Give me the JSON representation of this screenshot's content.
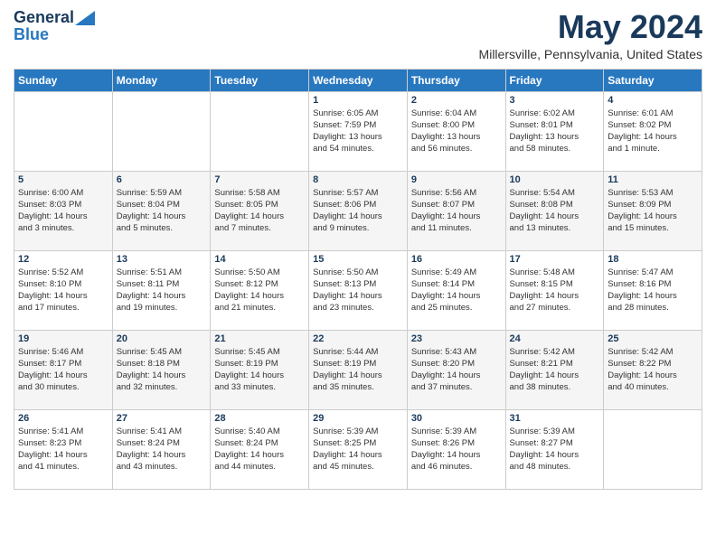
{
  "header": {
    "logo_line1": "General",
    "logo_line2": "Blue",
    "month_title": "May 2024",
    "location": "Millersville, Pennsylvania, United States"
  },
  "days_of_week": [
    "Sunday",
    "Monday",
    "Tuesday",
    "Wednesday",
    "Thursday",
    "Friday",
    "Saturday"
  ],
  "weeks": [
    [
      {
        "num": "",
        "info": ""
      },
      {
        "num": "",
        "info": ""
      },
      {
        "num": "",
        "info": ""
      },
      {
        "num": "1",
        "info": "Sunrise: 6:05 AM\nSunset: 7:59 PM\nDaylight: 13 hours\nand 54 minutes."
      },
      {
        "num": "2",
        "info": "Sunrise: 6:04 AM\nSunset: 8:00 PM\nDaylight: 13 hours\nand 56 minutes."
      },
      {
        "num": "3",
        "info": "Sunrise: 6:02 AM\nSunset: 8:01 PM\nDaylight: 13 hours\nand 58 minutes."
      },
      {
        "num": "4",
        "info": "Sunrise: 6:01 AM\nSunset: 8:02 PM\nDaylight: 14 hours\nand 1 minute."
      }
    ],
    [
      {
        "num": "5",
        "info": "Sunrise: 6:00 AM\nSunset: 8:03 PM\nDaylight: 14 hours\nand 3 minutes."
      },
      {
        "num": "6",
        "info": "Sunrise: 5:59 AM\nSunset: 8:04 PM\nDaylight: 14 hours\nand 5 minutes."
      },
      {
        "num": "7",
        "info": "Sunrise: 5:58 AM\nSunset: 8:05 PM\nDaylight: 14 hours\nand 7 minutes."
      },
      {
        "num": "8",
        "info": "Sunrise: 5:57 AM\nSunset: 8:06 PM\nDaylight: 14 hours\nand 9 minutes."
      },
      {
        "num": "9",
        "info": "Sunrise: 5:56 AM\nSunset: 8:07 PM\nDaylight: 14 hours\nand 11 minutes."
      },
      {
        "num": "10",
        "info": "Sunrise: 5:54 AM\nSunset: 8:08 PM\nDaylight: 14 hours\nand 13 minutes."
      },
      {
        "num": "11",
        "info": "Sunrise: 5:53 AM\nSunset: 8:09 PM\nDaylight: 14 hours\nand 15 minutes."
      }
    ],
    [
      {
        "num": "12",
        "info": "Sunrise: 5:52 AM\nSunset: 8:10 PM\nDaylight: 14 hours\nand 17 minutes."
      },
      {
        "num": "13",
        "info": "Sunrise: 5:51 AM\nSunset: 8:11 PM\nDaylight: 14 hours\nand 19 minutes."
      },
      {
        "num": "14",
        "info": "Sunrise: 5:50 AM\nSunset: 8:12 PM\nDaylight: 14 hours\nand 21 minutes."
      },
      {
        "num": "15",
        "info": "Sunrise: 5:50 AM\nSunset: 8:13 PM\nDaylight: 14 hours\nand 23 minutes."
      },
      {
        "num": "16",
        "info": "Sunrise: 5:49 AM\nSunset: 8:14 PM\nDaylight: 14 hours\nand 25 minutes."
      },
      {
        "num": "17",
        "info": "Sunrise: 5:48 AM\nSunset: 8:15 PM\nDaylight: 14 hours\nand 27 minutes."
      },
      {
        "num": "18",
        "info": "Sunrise: 5:47 AM\nSunset: 8:16 PM\nDaylight: 14 hours\nand 28 minutes."
      }
    ],
    [
      {
        "num": "19",
        "info": "Sunrise: 5:46 AM\nSunset: 8:17 PM\nDaylight: 14 hours\nand 30 minutes."
      },
      {
        "num": "20",
        "info": "Sunrise: 5:45 AM\nSunset: 8:18 PM\nDaylight: 14 hours\nand 32 minutes."
      },
      {
        "num": "21",
        "info": "Sunrise: 5:45 AM\nSunset: 8:19 PM\nDaylight: 14 hours\nand 33 minutes."
      },
      {
        "num": "22",
        "info": "Sunrise: 5:44 AM\nSunset: 8:19 PM\nDaylight: 14 hours\nand 35 minutes."
      },
      {
        "num": "23",
        "info": "Sunrise: 5:43 AM\nSunset: 8:20 PM\nDaylight: 14 hours\nand 37 minutes."
      },
      {
        "num": "24",
        "info": "Sunrise: 5:42 AM\nSunset: 8:21 PM\nDaylight: 14 hours\nand 38 minutes."
      },
      {
        "num": "25",
        "info": "Sunrise: 5:42 AM\nSunset: 8:22 PM\nDaylight: 14 hours\nand 40 minutes."
      }
    ],
    [
      {
        "num": "26",
        "info": "Sunrise: 5:41 AM\nSunset: 8:23 PM\nDaylight: 14 hours\nand 41 minutes."
      },
      {
        "num": "27",
        "info": "Sunrise: 5:41 AM\nSunset: 8:24 PM\nDaylight: 14 hours\nand 43 minutes."
      },
      {
        "num": "28",
        "info": "Sunrise: 5:40 AM\nSunset: 8:24 PM\nDaylight: 14 hours\nand 44 minutes."
      },
      {
        "num": "29",
        "info": "Sunrise: 5:39 AM\nSunset: 8:25 PM\nDaylight: 14 hours\nand 45 minutes."
      },
      {
        "num": "30",
        "info": "Sunrise: 5:39 AM\nSunset: 8:26 PM\nDaylight: 14 hours\nand 46 minutes."
      },
      {
        "num": "31",
        "info": "Sunrise: 5:39 AM\nSunset: 8:27 PM\nDaylight: 14 hours\nand 48 minutes."
      },
      {
        "num": "",
        "info": ""
      }
    ]
  ]
}
